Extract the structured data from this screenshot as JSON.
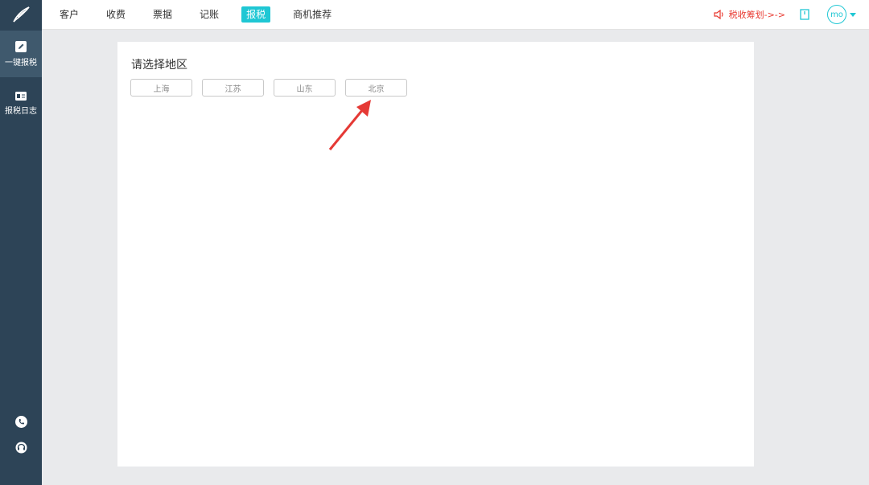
{
  "nav": {
    "items": [
      {
        "label": "客户"
      },
      {
        "label": "收费"
      },
      {
        "label": "票据"
      },
      {
        "label": "记账"
      },
      {
        "label": "报税",
        "active": true
      },
      {
        "label": "商机推荐"
      }
    ]
  },
  "header": {
    "promo_text": "税收筹划->->",
    "avatar_text": "mo"
  },
  "sidebar": {
    "items": [
      {
        "label": "一键报税",
        "icon": "edit-icon",
        "active": true
      },
      {
        "label": "报税日志",
        "icon": "log-card-icon"
      }
    ],
    "bottom_icons": [
      "phone-icon",
      "headset-support-icon"
    ]
  },
  "main": {
    "title": "请选择地区",
    "regions": [
      "上海",
      "江苏",
      "山东",
      "北京"
    ]
  },
  "colors": {
    "accent": "#1fc7d4",
    "sidebar": "#2d4457",
    "promo": "#e8382f",
    "annotation_arrow": "#e53935"
  }
}
